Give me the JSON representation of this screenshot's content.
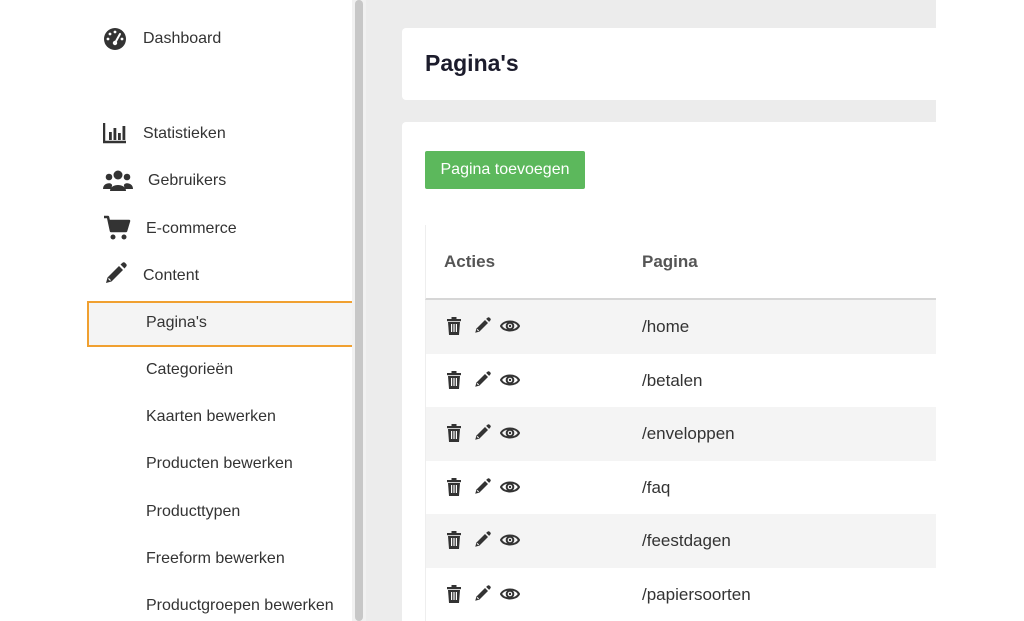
{
  "sidebar": {
    "items": [
      {
        "label": "Dashboard",
        "icon": "dashboard-icon"
      },
      {
        "label": "Statistieken",
        "icon": "chart-bar-icon"
      },
      {
        "label": "Gebruikers",
        "icon": "users-icon"
      },
      {
        "label": "E-commerce",
        "icon": "cart-icon"
      },
      {
        "label": "Content",
        "icon": "pencil-icon"
      }
    ],
    "content_sub_items": [
      {
        "label": "Pagina's",
        "active": true
      },
      {
        "label": "Categorieën"
      },
      {
        "label": "Kaarten bewerken"
      },
      {
        "label": "Producten bewerken"
      },
      {
        "label": "Producttypen"
      },
      {
        "label": "Freeform bewerken"
      },
      {
        "label": "Productgroepen bewerken"
      }
    ]
  },
  "main": {
    "title": "Pagina's",
    "add_button_label": "Pagina toevoegen",
    "table": {
      "headers": [
        "Acties",
        "Pagina"
      ],
      "rows": [
        "/home",
        "/betalen",
        "/enveloppen",
        "/faq",
        "/feestdagen",
        "/papiersoorten"
      ],
      "row_actions": [
        "trash-icon",
        "pencil-icon",
        "eye-icon"
      ]
    }
  },
  "colors": {
    "accent_highlight": "#f0a030",
    "add_button": "#5cb85c",
    "main_background": "#ececec"
  }
}
